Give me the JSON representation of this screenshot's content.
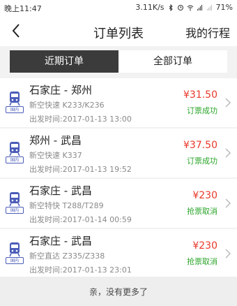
{
  "status_bar": {
    "time": "晚上11:47",
    "net_speed": "3.11K/s",
    "battery": "71%"
  },
  "header": {
    "title": "订单列表",
    "right_link": "我的行程"
  },
  "tabs": [
    {
      "label": "近期订单",
      "active": true
    },
    {
      "label": "全部订单",
      "active": false
    }
  ],
  "orders": [
    {
      "tag": "国内",
      "route": "石家庄 - 郑州",
      "train": "新空快速 K233/K236",
      "depart": "出发时间:2017-01-13 13:00",
      "price": "¥31.50",
      "status": "订票成功",
      "status_color": "#2aa52a"
    },
    {
      "tag": "国内",
      "route": "郑州 - 武昌",
      "train": "新空快速 K337",
      "depart": "出发时间:2017-01-13 19:52",
      "price": "¥37.50",
      "status": "订票成功",
      "status_color": "#2aa52a"
    },
    {
      "tag": "国内",
      "route": "石家庄 - 武昌",
      "train": "新空特快 T288/T289",
      "depart": "出发时间:2017-01-14 00:59",
      "price": "¥230",
      "status": "抢票取消",
      "status_color": "#2aa52a"
    },
    {
      "tag": "国内",
      "route": "石家庄 - 武昌",
      "train": "新空直达 Z335/Z338",
      "depart": "出发时间:2017-01-13 23:01",
      "price": "¥230",
      "status": "抢票取消",
      "status_color": "#2aa52a"
    }
  ],
  "footer": {
    "message": "亲，没有更多了"
  },
  "colors": {
    "price": "#e8392a",
    "tab_active_bg": "#3b3b3b",
    "tag": "#4b5cb8"
  }
}
